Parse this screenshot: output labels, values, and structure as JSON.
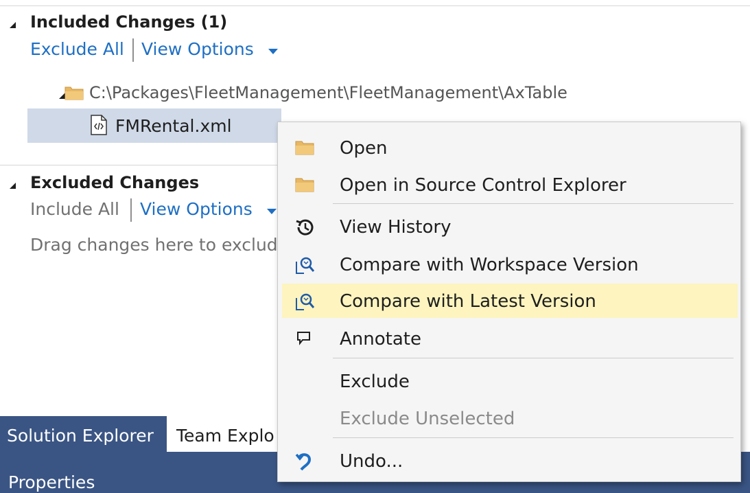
{
  "included": {
    "title": "Included Changes (1)",
    "exclude_all": "Exclude All",
    "view_options": "View Options",
    "folder_path": "C:\\Packages\\FleetManagement\\FleetManagement\\AxTable",
    "file_name": "FMRental.xml"
  },
  "excluded": {
    "title": "Excluded Changes",
    "include_all": "Include All",
    "view_options": "View Options",
    "hint": "Drag changes here to exclud"
  },
  "tabs": {
    "solution_explorer": "Solution Explorer",
    "team_explorer": "Team Explo"
  },
  "properties": {
    "title": "Properties"
  },
  "context_menu": {
    "items": [
      {
        "label": "Open",
        "icon": "folder-icon"
      },
      {
        "label": "Open in Source Control Explorer",
        "icon": "folder-icon"
      },
      {
        "label": "View History",
        "icon": "history-icon"
      },
      {
        "label": "Compare with Workspace Version",
        "icon": "compare-icon"
      },
      {
        "label": "Compare with Latest Version",
        "icon": "compare-icon"
      },
      {
        "label": "Annotate",
        "icon": "annotate-icon"
      },
      {
        "label": "Exclude",
        "icon": ""
      },
      {
        "label": "Exclude Unselected",
        "icon": "",
        "disabled": true
      },
      {
        "label": "Undo...",
        "icon": "undo-icon"
      }
    ]
  },
  "colors": {
    "link": "#1e6fc4",
    "selected_row": "#cfd9e8",
    "menu_highlight": "#fdf4bf",
    "tab_active": "#3a5584",
    "folder": "#e8b864",
    "undo": "#1e6fc4"
  }
}
